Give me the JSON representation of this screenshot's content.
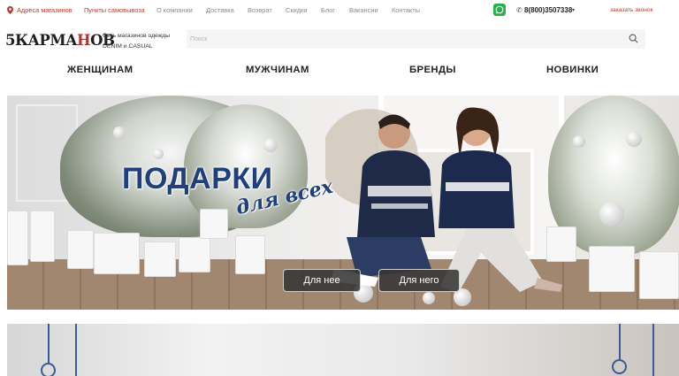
{
  "topbar": {
    "store_address": "Адреса магазинов",
    "links": [
      "Пункты самовывоза",
      "О компании",
      "Доставка",
      "Возврат",
      "Скидки",
      "Блог",
      "Вакансии",
      "Контакты"
    ],
    "phone": "8(800)3507338",
    "callback": "заказать звонок"
  },
  "header": {
    "logo_prefix": "5КАРМА",
    "logo_mid": "Н",
    "logo_suffix": "ОВ",
    "tagline_1": "Сеть магазинов одежды",
    "tagline_2": "DENIM и CASUAL",
    "search_placeholder": "Поиск"
  },
  "nav": [
    "ЖЕНЩИНАМ",
    "МУЖЧИНАМ",
    "БРЕНДЫ",
    "НОВИНКИ"
  ],
  "banner": {
    "title": "ПОДАРКИ",
    "subtitle": "для всех",
    "button_her": "Для нее",
    "button_him": "Для него"
  },
  "colors": {
    "accent_red": "#c0392b",
    "banner_blue": "#1f3f7e",
    "whatsapp_green": "#29b14a"
  }
}
